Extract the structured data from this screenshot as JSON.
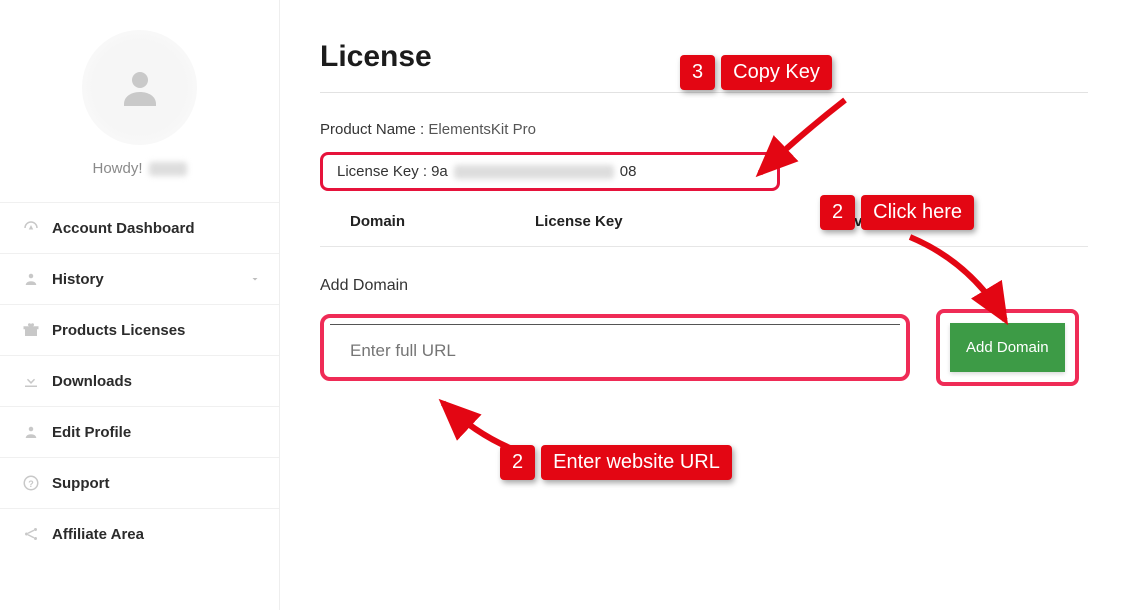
{
  "sidebar": {
    "greeting": "Howdy!",
    "items": [
      {
        "label": "Account Dashboard",
        "icon": "gauge"
      },
      {
        "label": "History",
        "icon": "user",
        "expandable": true
      },
      {
        "label": "Products Licenses",
        "icon": "gift"
      },
      {
        "label": "Downloads",
        "icon": "download"
      },
      {
        "label": "Edit Profile",
        "icon": "person"
      },
      {
        "label": "Support",
        "icon": "help"
      },
      {
        "label": "Affiliate Area",
        "icon": "share"
      }
    ]
  },
  "main": {
    "title": "License",
    "product_label": "Product Name :",
    "product_value": "ElementsKit Pro",
    "license_label": "License Key :",
    "license_prefix": "9a",
    "license_suffix": "08",
    "columns": {
      "domain": "Domain",
      "key": "License Key",
      "revoke": "Revoke"
    },
    "add_domain_label": "Add Domain",
    "url_placeholder": "Enter full URL",
    "add_button": "Add Domain"
  },
  "annotations": {
    "copy": {
      "num": "3",
      "text": "Copy Key"
    },
    "click": {
      "num": "2",
      "text": "Click here"
    },
    "enter": {
      "num": "2",
      "text": "Enter website URL"
    }
  }
}
